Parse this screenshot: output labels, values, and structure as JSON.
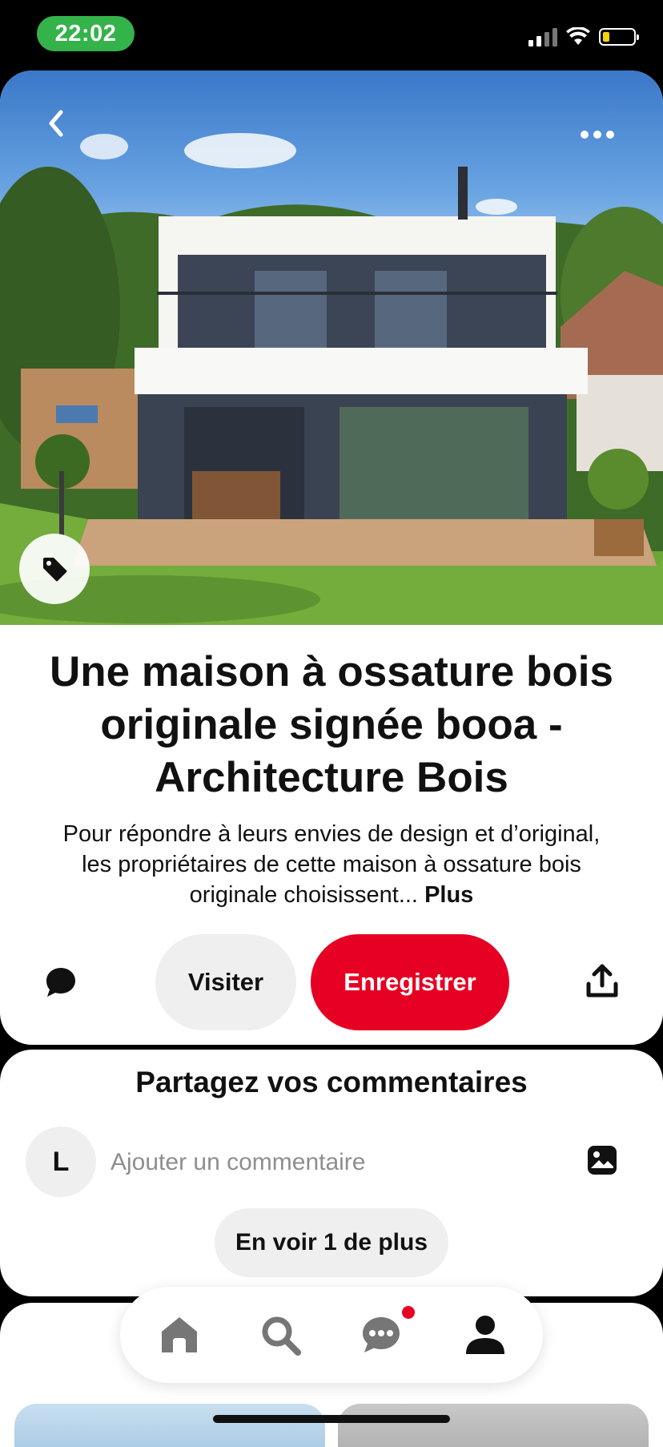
{
  "status_bar": {
    "time": "22:02",
    "time_pill_color": "#34b34a",
    "icons": [
      "cellular-signal-icon",
      "wifi-icon",
      "battery-icon"
    ]
  },
  "pin": {
    "title": "Une maison à ossature bois originale signée booa - Architecture Bois",
    "description": "Pour répondre à leurs envies de design et d’original, les propriétaires de cette maison à ossature bois originale choisissent...",
    "more_label": "Plus",
    "image_icons": [
      "back-arrow-icon",
      "more-options-icon",
      "product-tag-icon"
    ]
  },
  "actions": {
    "visit_label": "Visiter",
    "save_label": "Enregistrer",
    "save_color": "#e60023",
    "icons": [
      "comment-bubble-icon",
      "share-icon"
    ]
  },
  "comments": {
    "heading": "Partagez vos commentaires",
    "avatar_initial": "L",
    "input_placeholder": "Ajouter un commentaire",
    "see_more_label": "En voir 1 de plus"
  },
  "bottom_nav": {
    "items": [
      "home-icon",
      "search-icon",
      "messages-icon",
      "profile-icon"
    ],
    "notification_color": "#e60023"
  }
}
